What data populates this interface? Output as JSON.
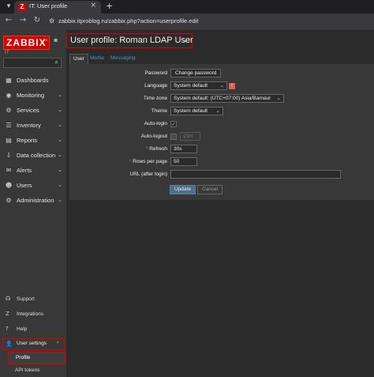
{
  "browser": {
    "tab_title": "IT: User profile",
    "tab_favicon": "Z",
    "url": "zabbix.itproblog.ru/zabbix.php?action=userprofile.edit",
    "icons": [
      "menu-icon",
      "close-icon",
      "plus-icon",
      "back-icon",
      "forward-icon",
      "reload-icon",
      "site-info-icon"
    ]
  },
  "sidebar": {
    "logo": "ZABBIX",
    "server_name": "IT",
    "search_placeholder": "",
    "menu": [
      {
        "label": "Dashboards",
        "icon": "dashboard-icon",
        "has_submenu": false
      },
      {
        "label": "Monitoring",
        "icon": "eye-icon",
        "has_submenu": true
      },
      {
        "label": "Services",
        "icon": "services-icon",
        "has_submenu": true
      },
      {
        "label": "Inventory",
        "icon": "list-icon",
        "has_submenu": true
      },
      {
        "label": "Reports",
        "icon": "reports-icon",
        "has_submenu": true
      },
      {
        "label": "Data collection",
        "icon": "download-icon",
        "has_submenu": true
      },
      {
        "label": "Alerts",
        "icon": "envelope-icon",
        "has_submenu": true
      },
      {
        "label": "Users",
        "icon": "users-icon",
        "has_submenu": true
      },
      {
        "label": "Administration",
        "icon": "gear-icon",
        "has_submenu": true
      }
    ],
    "bottom": [
      {
        "label": "Support",
        "icon": "headset-icon"
      },
      {
        "label": "Integrations",
        "icon": "integrations-icon"
      },
      {
        "label": "Help",
        "icon": "help-icon"
      }
    ],
    "user_settings": {
      "label": "User settings",
      "icon": "user-icon"
    },
    "submenu": [
      {
        "label": "Profile",
        "active": true
      },
      {
        "label": "API tokens",
        "active": false
      }
    ]
  },
  "main": {
    "title": "User profile: Roman LDAP User",
    "tabs": [
      {
        "label": "User",
        "active": true
      },
      {
        "label": "Media",
        "active": false
      },
      {
        "label": "Messaging",
        "active": false
      }
    ],
    "form": {
      "password_label": "Password",
      "change_password_button": "Change password",
      "language_label": "Language",
      "language_value": "System default",
      "language_warning": "!",
      "timezone_label": "Time zone",
      "timezone_value": "System default: (UTC+07:00) Asia/Barnaul",
      "theme_label": "Theme",
      "theme_value": "System default",
      "autologin_label": "Auto-login",
      "autologin_checked": true,
      "autologout_label": "Auto-logout",
      "autologout_checked": false,
      "autologout_value": "15m",
      "refresh_label": "Refresh",
      "refresh_value": "30s",
      "rows_label": "Rows per page",
      "rows_value": "50",
      "url_label": "URL (after login)",
      "url_value": "",
      "update_button": "Update",
      "cancel_button": "Cancel"
    }
  }
}
